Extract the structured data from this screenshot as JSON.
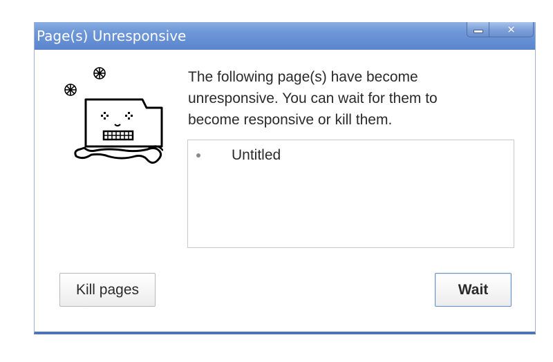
{
  "window": {
    "title": "Page(s) Unresponsive",
    "controls": {
      "minimize_glyph": "minimize-icon",
      "close_glyph": "✕"
    }
  },
  "illustration": {
    "icon": "sad-tab-illustration-icon"
  },
  "message": {
    "text": "The following page(s) have become unresponsive. You can wait for them to become responsive or kill them."
  },
  "page_list": {
    "items": [
      {
        "label": "Untitled"
      }
    ]
  },
  "buttons": {
    "kill_label": "Kill pages",
    "wait_label": "Wait"
  },
  "colors": {
    "titlebar": "#6f98d8",
    "border_accent": "#4f74b3",
    "title_text": "#ffffff"
  }
}
